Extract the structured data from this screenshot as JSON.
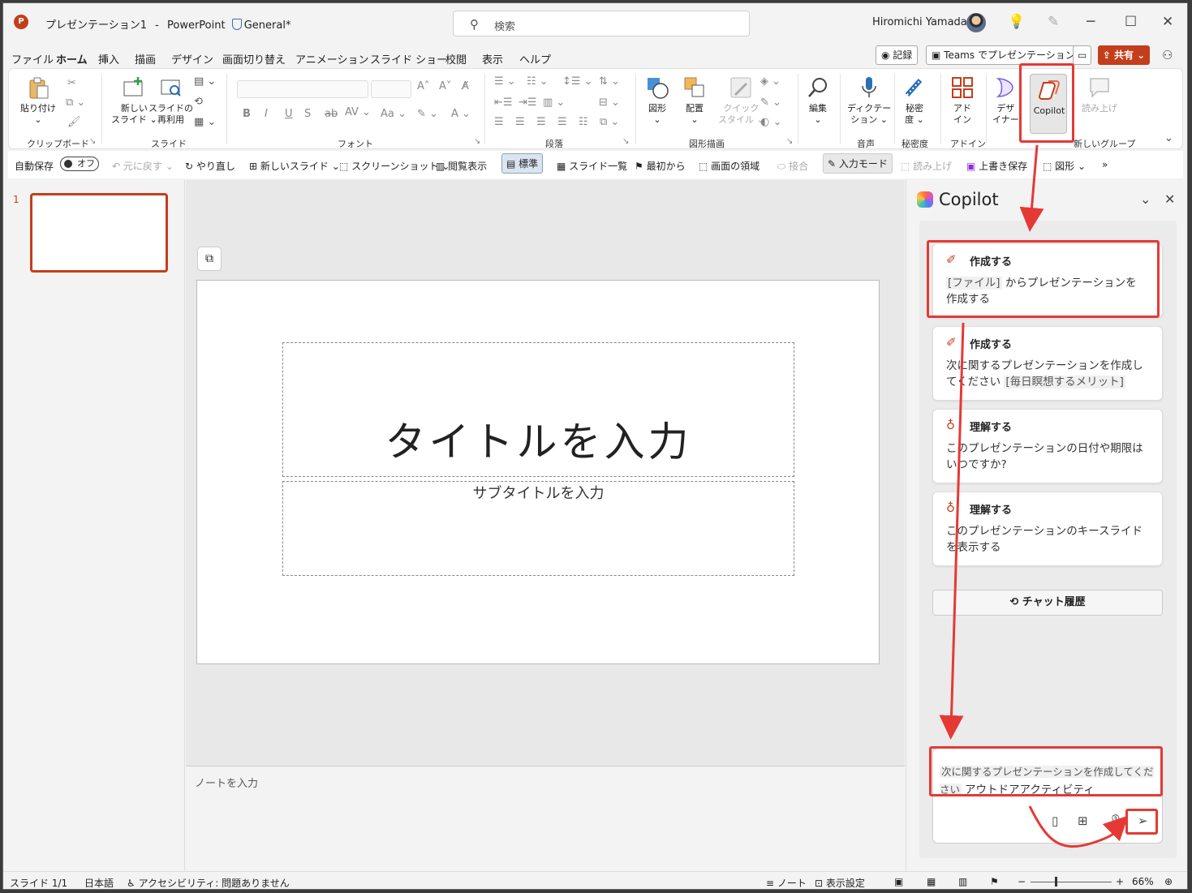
{
  "window": {
    "doc_name": "プレゼンテーション1",
    "separator": "-",
    "app_name": "PowerPoint",
    "sensitivity": "General*",
    "search_placeholder": "検索",
    "user": "Hiromichi Yamada"
  },
  "tabs": [
    "ファイル",
    "ホーム",
    "挿入",
    "描画",
    "デザイン",
    "画面切り替え",
    "アニメーション",
    "スライド ショー",
    "校閲",
    "表示",
    "ヘルプ"
  ],
  "active_tab": "ホーム",
  "header_buttons": {
    "record": "記録",
    "teams": "Teams でプレゼンテーション",
    "share": "共有"
  },
  "ribbon": {
    "paste": "貼り付け",
    "new_slide_1": "新しい",
    "new_slide_2": "スライド",
    "reuse_1": "スライドの",
    "reuse_2": "再利用",
    "shapes": "図形",
    "arrange": "配置",
    "quick_1": "クイック",
    "quick_2": "スタイル",
    "edit": "編集",
    "dictate_1": "ディクテー",
    "dictate_2": "ション",
    "sensitivity_1": "秘密",
    "sensitivity_2": "度",
    "addin_1": "アド",
    "addin_2": "イン",
    "designer_1": "デザ",
    "designer_2": "イナー",
    "copilot": "Copilot",
    "read_aloud": "読み上げ",
    "groups": {
      "clipboard": "クリップボード",
      "slides": "スライド",
      "font": "フォント",
      "paragraph": "段落",
      "drawing": "図形描画",
      "voice": "音声",
      "sensitivity": "秘密度",
      "addins": "アドイン",
      "new_group": "新しいグループ"
    }
  },
  "qat": {
    "autosave": "自動保存",
    "autosave_state": "オフ",
    "undo": "元に戻す",
    "redo": "やり直し",
    "new_slide": "新しいスライド",
    "screenshot": "スクリーンショット",
    "reading_view": "閲覧表示",
    "normal": "標準",
    "slide_sorter": "スライド一覧",
    "from_beginning": "最初から",
    "screen_clip": "画面の領域",
    "merge": "接合",
    "input_mode": "入力モード",
    "read_aloud": "読み上げ",
    "save": "上書き保存",
    "shapes": "図形"
  },
  "slides": {
    "number": "1",
    "title_placeholder": "タイトルを入力",
    "subtitle_placeholder": "サブタイトルを入力",
    "notes_placeholder": "ノートを入力"
  },
  "copilot": {
    "title": "Copilot",
    "cards": [
      {
        "heading": "作成する",
        "chip1": "[ファイル]",
        "text": " からプレゼンテーションを作成する",
        "icon": "pen-icon"
      },
      {
        "heading": "作成する",
        "text": "次に関するプレゼンテーションを作成してください ",
        "chip1": "[毎日瞑想するメリット]",
        "icon": "pen-icon"
      },
      {
        "heading": "理解する",
        "text": "このプレゼンテーションの日付や期限はいつですか?",
        "icon": "lightbulb-icon"
      },
      {
        "heading": "理解する",
        "text": "このプレゼンテーションのキースライドを表示する",
        "icon": "lightbulb-icon"
      }
    ],
    "history": "チャット履歴",
    "prompt_prefix": "次に関するプレゼンテーションを作成してください",
    "prompt_value": "アウトドアアクティビティ"
  },
  "status": {
    "slide": "スライド 1/1",
    "language": "日本語",
    "accessibility": "アクセシビリティ: 問題ありません",
    "notes": "ノート",
    "display_settings": "表示設定",
    "zoom": "66%"
  },
  "colors": {
    "accent": "#c43e1c",
    "annotation": "#e53935"
  }
}
